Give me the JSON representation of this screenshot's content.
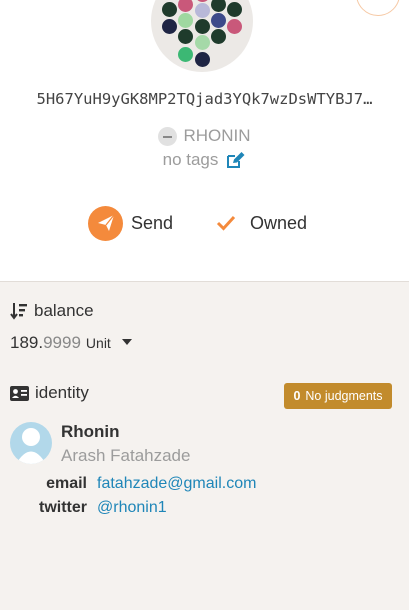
{
  "account": {
    "address": "5H67YuH9yGK8MP2TQjad3YQk7wzDsWTYBJ7…",
    "display_name": "RHONIN",
    "tags": "no tags"
  },
  "actions": {
    "send_label": "Send",
    "owned_label": "Owned"
  },
  "balance": {
    "label": "balance",
    "integer": "189.",
    "fraction": "9999",
    "unit": "Unit"
  },
  "identity": {
    "label": "identity",
    "judgments_count": "0",
    "judgments_label": "No judgments",
    "display": "Rhonin",
    "legal": "Arash Fatahzade",
    "email_label": "email",
    "email": "fatahzade@gmail.com",
    "twitter_label": "twitter",
    "twitter": "@rhonin1"
  },
  "colors": {
    "accent": "#f48a3c",
    "badge": "#c28b2c",
    "link": "#1f86b8",
    "muted_text": "#9c9c9c",
    "section_bg": "#f5f2ef"
  }
}
